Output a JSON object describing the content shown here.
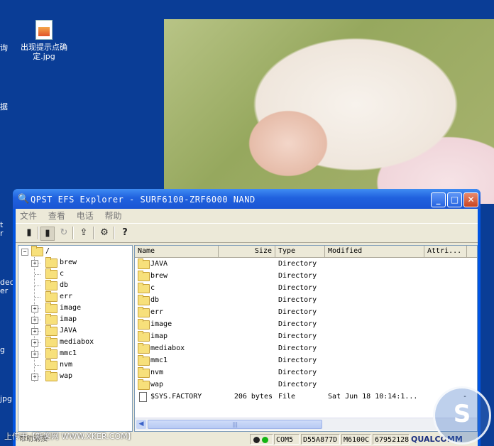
{
  "desktop": {
    "icon_label_line1": "出现提示点确",
    "icon_label_line2": "定.jpg",
    "edge_labels": [
      "询",
      "据",
      "t",
      "r",
      "deo",
      "er",
      "g",
      "jpg"
    ]
  },
  "window": {
    "title": "QPST EFS Explorer - SURF6100-ZRF6000 NAND",
    "buttons": {
      "minimize": "_",
      "maximize": "□",
      "close": "✕"
    }
  },
  "menu": [
    "文件",
    "查看",
    "电话",
    "帮助"
  ],
  "toolbar": {
    "icons": [
      "phone-icon",
      "phone-connect-icon",
      "refresh-icon",
      "folder-up-icon",
      "settings-icon",
      "help-icon"
    ],
    "glyphs": [
      "▮",
      "▮",
      "↻",
      "⇪",
      "⚙",
      "?"
    ]
  },
  "tree": {
    "root": "/",
    "items": [
      {
        "label": "brew",
        "expandable": true
      },
      {
        "label": "c",
        "expandable": false
      },
      {
        "label": "db",
        "expandable": false
      },
      {
        "label": "err",
        "expandable": false
      },
      {
        "label": "image",
        "expandable": true
      },
      {
        "label": "imap",
        "expandable": true
      },
      {
        "label": "JAVA",
        "expandable": true
      },
      {
        "label": "mediabox",
        "expandable": true
      },
      {
        "label": "mmc1",
        "expandable": true
      },
      {
        "label": "nvm",
        "expandable": false
      },
      {
        "label": "wap",
        "expandable": true
      }
    ]
  },
  "list": {
    "columns": [
      "Name",
      "Size",
      "Type",
      "Modified",
      "Attri..."
    ],
    "rows": [
      {
        "name": "JAVA",
        "size": "",
        "type": "Directory",
        "modified": "",
        "attr": "",
        "kind": "folder"
      },
      {
        "name": "brew",
        "size": "",
        "type": "Directory",
        "modified": "",
        "attr": "",
        "kind": "folder"
      },
      {
        "name": "c",
        "size": "",
        "type": "Directory",
        "modified": "",
        "attr": "",
        "kind": "folder"
      },
      {
        "name": "db",
        "size": "",
        "type": "Directory",
        "modified": "",
        "attr": "",
        "kind": "folder"
      },
      {
        "name": "err",
        "size": "",
        "type": "Directory",
        "modified": "",
        "attr": "",
        "kind": "folder"
      },
      {
        "name": "image",
        "size": "",
        "type": "Directory",
        "modified": "",
        "attr": "",
        "kind": "folder"
      },
      {
        "name": "imap",
        "size": "",
        "type": "Directory",
        "modified": "",
        "attr": "",
        "kind": "folder"
      },
      {
        "name": "mediabox",
        "size": "",
        "type": "Directory",
        "modified": "",
        "attr": "",
        "kind": "folder"
      },
      {
        "name": "mmc1",
        "size": "",
        "type": "Directory",
        "modified": "",
        "attr": "",
        "kind": "folder"
      },
      {
        "name": "nvm",
        "size": "",
        "type": "Directory",
        "modified": "",
        "attr": "",
        "kind": "folder"
      },
      {
        "name": "wap",
        "size": "",
        "type": "Directory",
        "modified": "",
        "attr": "",
        "kind": "folder"
      },
      {
        "name": "$SYS.FACTORY",
        "size": "206 bytes",
        "type": "File",
        "modified": "Sat Jun 18 10:14:1...",
        "attr": "-",
        "kind": "file"
      }
    ]
  },
  "status": {
    "left_text": "帮助请按",
    "port": "COM5",
    "esn": "D55A877D",
    "model": "M6100C-",
    "build": "67952128",
    "brand": "QUALCOMM"
  },
  "watermark": {
    "text": "上传于【新客网 WWW.XKER.COM】",
    "logo_letter": "S"
  }
}
